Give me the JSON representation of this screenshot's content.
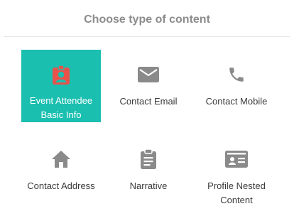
{
  "dialog": {
    "title": "Choose type of content"
  },
  "colors": {
    "accent": "#1bbfb0",
    "icon": "#8a8a8a",
    "selected_icon": "#e8524a",
    "title": "#8c8c8c",
    "label": "#3a3a3a"
  },
  "tiles": [
    {
      "label": "Event Attendee Basic Info",
      "icon": "badge-icon",
      "selected": true
    },
    {
      "label": "Contact Email",
      "icon": "envelope-icon",
      "selected": false
    },
    {
      "label": "Contact Mobile",
      "icon": "phone-icon",
      "selected": false
    },
    {
      "label": "Contact Address",
      "icon": "home-icon",
      "selected": false
    },
    {
      "label": "Narrative",
      "icon": "clipboard-icon",
      "selected": false
    },
    {
      "label": "Profile Nested Content",
      "icon": "id-card-icon",
      "selected": false
    }
  ]
}
